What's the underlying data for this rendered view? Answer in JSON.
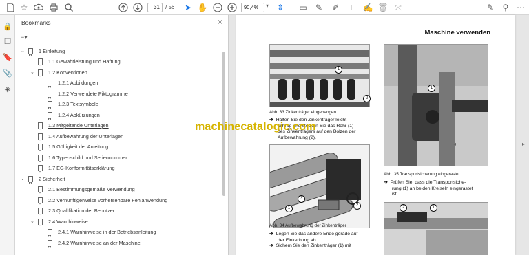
{
  "toolbar": {
    "page_current": "31",
    "page_total": "/ 56",
    "zoom": "90,4%"
  },
  "panel": {
    "title": "Bookmarks",
    "close": "×",
    "options_icon": "≡▾"
  },
  "bookmarks": [
    {
      "label": "1 Einleitung",
      "level": 0,
      "chev": "v"
    },
    {
      "label": "1.1 Gewährleistung und Haftung",
      "level": 1,
      "chev": ""
    },
    {
      "label": "1.2 Konventionen",
      "level": 1,
      "chev": "v"
    },
    {
      "label": "1.2.1 Abbildungen",
      "level": 2,
      "chev": ""
    },
    {
      "label": "1.2.2 Verwendete Piktogramme",
      "level": 2,
      "chev": ""
    },
    {
      "label": "1.2.3 Textsymbole",
      "level": 2,
      "chev": ""
    },
    {
      "label": "1.2.4 Abkürzungen",
      "level": 2,
      "chev": ""
    },
    {
      "label": "1.3 Mitgeltende Unterlagen",
      "level": 1,
      "chev": "",
      "underline": true
    },
    {
      "label": "1.4 Aufbewahrung der Unterlagen",
      "level": 1,
      "chev": ""
    },
    {
      "label": "1.5 Gültigkeit der Anleitung",
      "level": 1,
      "chev": ""
    },
    {
      "label": "1.6 Typenschild und Seriennummer",
      "level": 1,
      "chev": ""
    },
    {
      "label": "1.7 EG-Konformitätserklärung",
      "level": 1,
      "chev": ""
    },
    {
      "label": "2 Sicherheit",
      "level": 0,
      "chev": "v"
    },
    {
      "label": "2.1 Bestimmungsgemäße Verwendung",
      "level": 1,
      "chev": ""
    },
    {
      "label": "2.2 Vernünftigerweise vorhersehbare Fehlanwendung",
      "level": 1,
      "chev": ""
    },
    {
      "label": "2.3 Qualifikation der Benutzer",
      "level": 1,
      "chev": ""
    },
    {
      "label": "2.4 Warnhinweise",
      "level": 1,
      "chev": "v"
    },
    {
      "label": "2.4.1 Warnhinweise in der Betriebsanleitung",
      "level": 2,
      "chev": ""
    },
    {
      "label": "2.4.2 Warnhinweise an der Maschine",
      "level": 2,
      "chev": ""
    }
  ],
  "doc": {
    "section_title": "Maschine verwenden",
    "fig33_caption": "Abb. 33   Zinkenträger eingehangen",
    "fig33_text_1": "Halten Sie den Zinkenträger leicht",
    "fig33_text_2": "schräg und stecken Sie das Rohr (1)",
    "fig33_text_3": "des Zinkenträgers auf den Bolzen der",
    "fig33_text_4": "Aufbewahrung (2).",
    "fig34_caption": "Abb. 34   Aufbewahrung der Zinkenträger",
    "fig34_text_1": "Legen Sie das andere Ende gerade auf",
    "fig34_text_2": "der Einkerbung ab.",
    "fig34_text_3": "Sichern Sie den Zinkenträger (1) mit",
    "fig35_caption": "Abb. 35   Transportsicherung eingerastet",
    "fig35_text_1": "Prüfen Sie, dass die Transportsiche-",
    "fig35_text_2": "rung (1) an beiden Kreiseln eingerastet",
    "fig35_text_3": "ist.",
    "callout_1": "1",
    "callout_2": "2",
    "callout_3": "3",
    "watermark": "machinecatalogic.com",
    "arrow": "➔"
  }
}
